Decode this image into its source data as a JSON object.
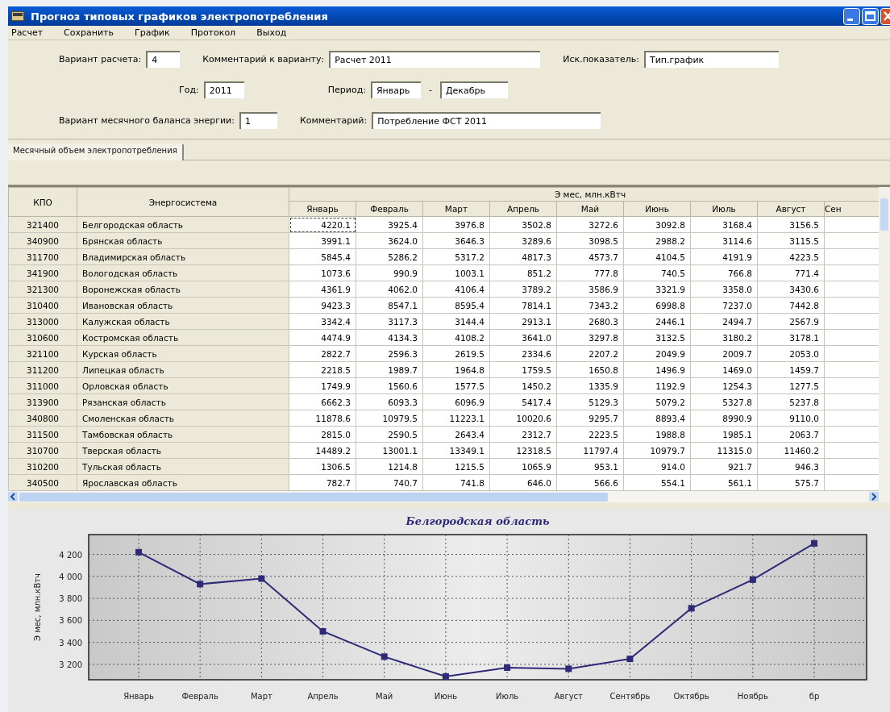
{
  "window": {
    "title": "Прогноз типовых графиков электропотребления"
  },
  "menu": [
    "Расчет",
    "Сохранить",
    "График",
    "Протокол",
    "Выход"
  ],
  "form": [
    [
      {
        "label": "Вариант расчета:",
        "value": "4"
      },
      {
        "label": "Комментарий к варианту:",
        "value": "Расчет 2011"
      },
      {
        "label": "Иск.показатель:",
        "value": "Тип.график"
      }
    ],
    [
      {
        "label": "Год:",
        "value": "2011"
      },
      {
        "label": "Период:",
        "value": "Январь",
        "separator": "-",
        "value_to": "Декабрь"
      }
    ],
    [
      {
        "label": "Вариант месячного баланса энергии:",
        "value": "1"
      },
      {
        "label": "Комментарий:",
        "value": "Потребление ФСТ 2011"
      }
    ]
  ],
  "tabs": [
    {
      "label": "Месячный объем электропотребления",
      "selected": true
    }
  ],
  "table": {
    "columns": [
      "КПО",
      "Энергосистема"
    ],
    "group_header": "Э мес, млн.кВтч",
    "month_columns": [
      "Январь",
      "Февраль",
      "Март",
      "Апрель",
      "Май",
      "Июнь",
      "Июль",
      "Август",
      "Сен"
    ],
    "rows": [
      {
        "code": "321400",
        "name": "Белгородская область",
        "values": [
          "4220.1",
          "3925.4",
          "3976.8",
          "3502.8",
          "3272.6",
          "3092.8",
          "3168.4",
          "3156.5"
        ],
        "selected": true
      },
      {
        "code": "340900",
        "name": "Брянская область",
        "values": [
          "3991.1",
          "3624.0",
          "3646.3",
          "3289.6",
          "3098.5",
          "2988.2",
          "3114.6",
          "3115.5"
        ],
        "selected": false
      },
      {
        "code": "311700",
        "name": "Владимирская область",
        "values": [
          "5845.4",
          "5286.2",
          "5317.2",
          "4817.3",
          "4573.7",
          "4104.5",
          "4191.9",
          "4223.5"
        ],
        "selected": false
      },
      {
        "code": "341900",
        "name": "Вологодская область",
        "values": [
          "1073.6",
          "990.9",
          "1003.1",
          "851.2",
          "777.8",
          "740.5",
          "766.8",
          "771.4"
        ],
        "selected": false
      },
      {
        "code": "321300",
        "name": "Воронежская область",
        "values": [
          "4361.9",
          "4062.0",
          "4106.4",
          "3789.2",
          "3586.9",
          "3321.9",
          "3358.0",
          "3430.6"
        ],
        "selected": false
      },
      {
        "code": "310400",
        "name": "Ивановская область",
        "values": [
          "9423.3",
          "8547.1",
          "8595.4",
          "7814.1",
          "7343.2",
          "6998.8",
          "7237.0",
          "7442.8"
        ],
        "selected": false
      },
      {
        "code": "313000",
        "name": "Калужская область",
        "values": [
          "3342.4",
          "3117.3",
          "3144.4",
          "2913.1",
          "2680.3",
          "2446.1",
          "2494.7",
          "2567.9"
        ],
        "selected": false
      },
      {
        "code": "310600",
        "name": "Костромская область",
        "values": [
          "4474.9",
          "4134.3",
          "4108.2",
          "3641.0",
          "3297.8",
          "3132.5",
          "3180.2",
          "3178.1"
        ],
        "selected": false
      },
      {
        "code": "321100",
        "name": "Курская область",
        "values": [
          "2822.7",
          "2596.3",
          "2619.5",
          "2334.6",
          "2207.2",
          "2049.9",
          "2009.7",
          "2053.0"
        ],
        "selected": false
      },
      {
        "code": "311200",
        "name": "Липецкая область",
        "values": [
          "2218.5",
          "1989.7",
          "1964.8",
          "1759.5",
          "1650.8",
          "1496.9",
          "1469.0",
          "1459.7"
        ],
        "selected": false
      },
      {
        "code": "311000",
        "name": "Орловская область",
        "values": [
          "1749.9",
          "1560.6",
          "1577.5",
          "1450.2",
          "1335.9",
          "1192.9",
          "1254.3",
          "1277.5"
        ],
        "selected": false
      },
      {
        "code": "313900",
        "name": "Рязанская область",
        "values": [
          "6662.3",
          "6093.3",
          "6096.9",
          "5417.4",
          "5129.3",
          "5079.2",
          "5327.8",
          "5237.8"
        ],
        "selected": false
      },
      {
        "code": "340800",
        "name": "Смоленская область",
        "values": [
          "11878.6",
          "10979.5",
          "11223.1",
          "10020.6",
          "9295.7",
          "8893.4",
          "8990.9",
          "9110.0"
        ],
        "selected": false
      },
      {
        "code": "311500",
        "name": "Тамбовская область",
        "values": [
          "2815.0",
          "2590.5",
          "2643.4",
          "2312.7",
          "2223.5",
          "1988.8",
          "1985.1",
          "2063.7"
        ],
        "selected": false
      },
      {
        "code": "310700",
        "name": "Тверская область",
        "values": [
          "14489.2",
          "13001.1",
          "13349.1",
          "12318.5",
          "11797.4",
          "10979.7",
          "11315.0",
          "11460.2"
        ],
        "selected": false
      },
      {
        "code": "310200",
        "name": "Тульская область",
        "values": [
          "1306.5",
          "1214.8",
          "1215.5",
          "1065.9",
          "953.1",
          "914.0",
          "921.7",
          "946.3"
        ],
        "selected": false
      },
      {
        "code": "340500",
        "name": "Ярославская область",
        "values": [
          "782.7",
          "740.7",
          "741.8",
          "646.0",
          "566.6",
          "554.1",
          "561.1",
          "575.7"
        ],
        "selected": false
      }
    ]
  },
  "chart_data": {
    "type": "line",
    "title": "Белгородская область",
    "ylabel": "Э мес, млн.кВтч",
    "categories": [
      "Январь",
      "Февраль",
      "Март",
      "Апрель",
      "Май",
      "Июнь",
      "Июль",
      "Август",
      "Сентябрь",
      "Октябрь",
      "Ноябрь",
      "бр"
    ],
    "grid": true,
    "series": [
      {
        "color": "#2e2a78",
        "marker": "square",
        "values": [
          4220,
          3930,
          3980,
          3500,
          3270,
          3090,
          3170,
          3160,
          3250,
          3710,
          3970,
          4300
        ]
      }
    ],
    "ylim": [
      3060,
      4380
    ],
    "yticks": [
      {
        "value": 3200,
        "label": "3 200"
      },
      {
        "value": 3400,
        "label": "3 400"
      },
      {
        "value": 3600,
        "label": "3 600"
      },
      {
        "value": 3800,
        "label": "3 800"
      },
      {
        "value": 4000,
        "label": "4 000"
      },
      {
        "value": 4200,
        "label": "4 200"
      }
    ]
  }
}
